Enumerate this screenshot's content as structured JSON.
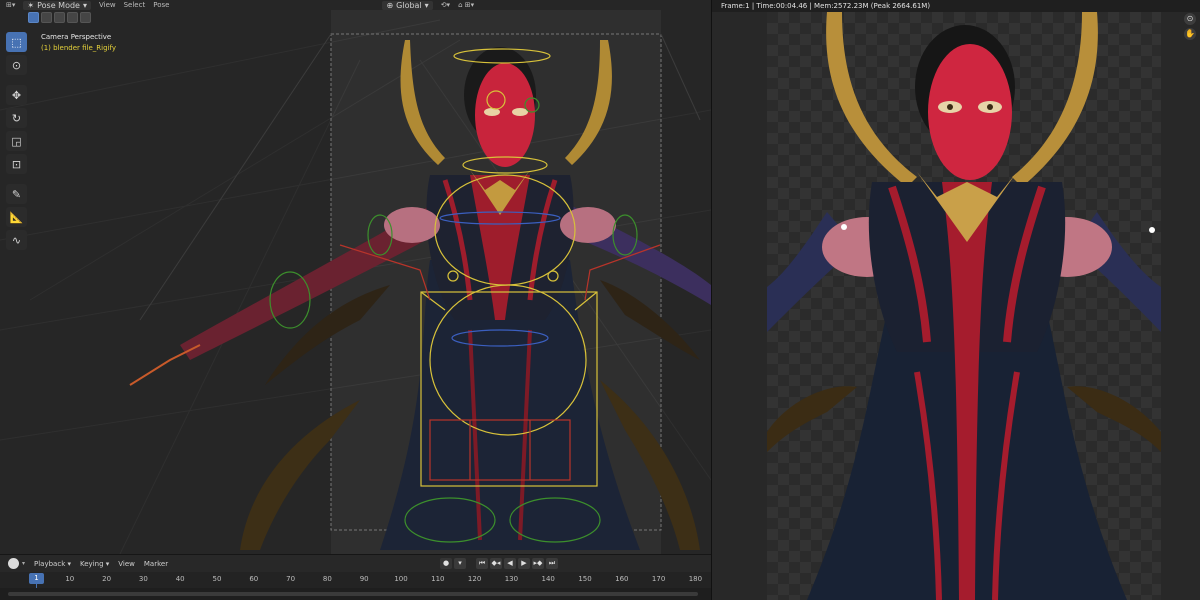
{
  "viewport": {
    "header": {
      "mode": "Pose Mode",
      "menus": [
        "View",
        "Select",
        "Pose"
      ],
      "pivot": "Global"
    },
    "overlay": {
      "camera_label": "Camera Perspective",
      "object_label": "(1) blender file_Rigify"
    },
    "toolbar": [
      "select-box",
      "cursor",
      "move",
      "rotate",
      "scale",
      "transform",
      "annotate",
      "measure",
      "relax"
    ]
  },
  "timeline": {
    "menus": {
      "playback": "Playback",
      "keying": "Keying",
      "view": "View",
      "marker": "Marker"
    },
    "current_frame": "1",
    "ticks": [
      "10",
      "20",
      "30",
      "40",
      "50",
      "60",
      "70",
      "80",
      "90",
      "100",
      "110",
      "120",
      "130",
      "140",
      "150",
      "160",
      "170",
      "180"
    ]
  },
  "render_window": {
    "status": "Frame:1 | Time:00:04.46 | Mem:2572.23M (Peak 2664.61M)"
  },
  "colors": {
    "accent": "#4772b3",
    "object_label": "#e6d23b",
    "rig_yellow": "#d8c23a",
    "rig_green": "#3c8f2c",
    "rig_red": "#b8342a",
    "rig_blue": "#3b5fc0"
  }
}
